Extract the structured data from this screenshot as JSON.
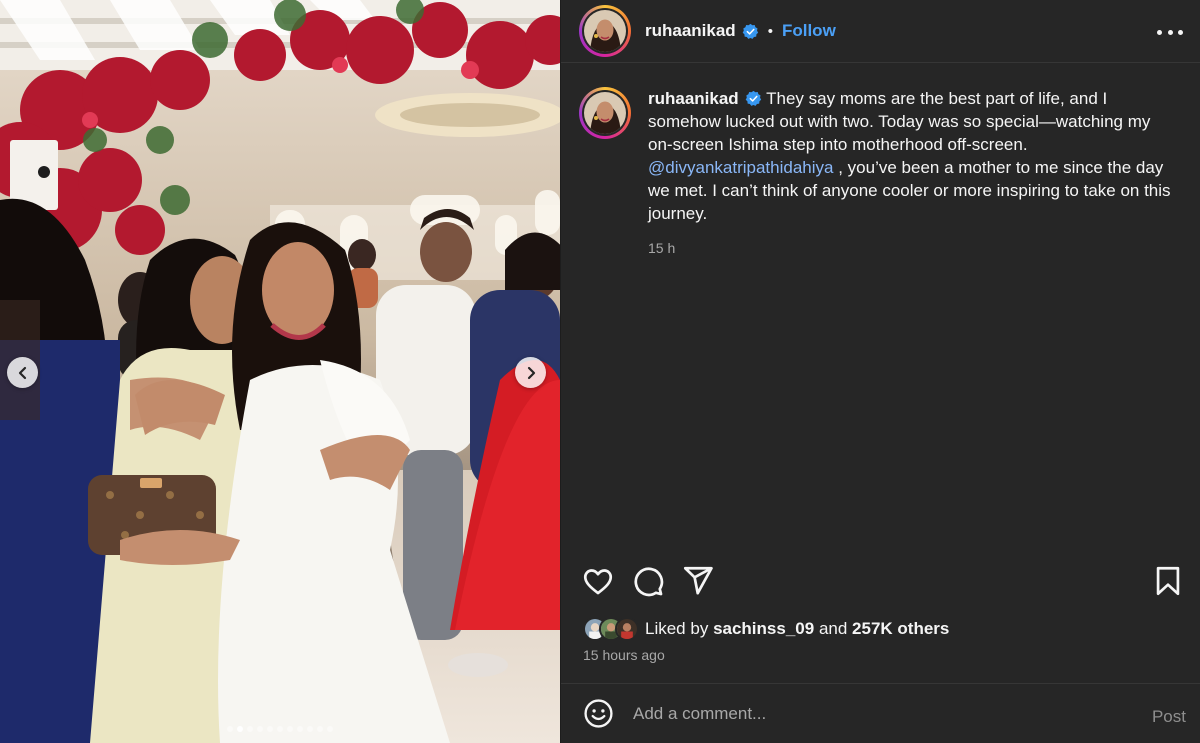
{
  "post": {
    "username": "ruhaanikad",
    "verified": true,
    "separator": "•",
    "follow_label": "Follow",
    "more_icon": "more-horizontal-icon",
    "caption": {
      "username": "ruhaanikad",
      "text_before_mention": "They say moms are the best part of life, and I somehow lucked out with two. Today was so special—watching my on-screen Ishima step into motherhood off-screen.",
      "mention": "@divyankatripathidahiya",
      "text_after_mention": ", you’ve been a mother to me since the day we met. I can’t think of anyone cooler or more inspiring to take on this journey.",
      "time": "15 h"
    },
    "carousel": {
      "total_slides": 11,
      "active_index": 1,
      "prev_icon": "chevron-left-icon",
      "next_icon": "chevron-right-icon"
    },
    "actions": {
      "like_icon": "heart-icon",
      "comment_icon": "comment-bubble-icon",
      "share_icon": "paper-plane-icon",
      "save_icon": "bookmark-icon"
    },
    "likes": {
      "prefix": "Liked by",
      "user": "sachinss_09",
      "joiner": "and",
      "others": "257K others"
    },
    "posted": "15 hours ago",
    "comment": {
      "emoji_icon": "smiley-icon",
      "placeholder": "Add a comment...",
      "post_label": "Post"
    }
  },
  "colors": {
    "panel_bg": "#262626",
    "primary_text": "#f5f5f5",
    "secondary_text": "#a8a8a8",
    "link_blue": "#4ba0f6",
    "mention_blue": "#8ab7f7",
    "verified_blue": "#3797f0"
  }
}
